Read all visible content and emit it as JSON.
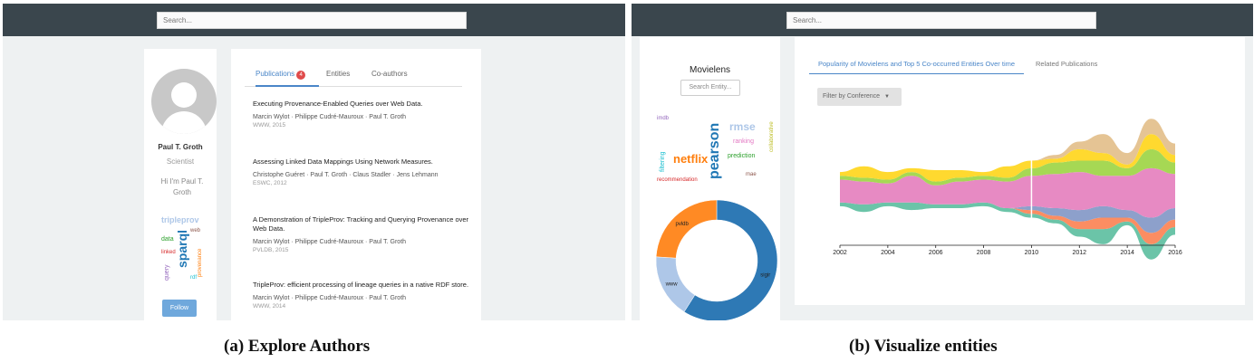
{
  "panel_a": {
    "search_placeholder": "Search...",
    "profile": {
      "name": "Paul T. Groth",
      "role": "Scientist",
      "greeting": "Hi I'm Paul T. Groth",
      "follow_label": "Follow",
      "word_cloud": [
        "tripleprov",
        "sparql",
        "data",
        "linked",
        "query",
        "web",
        "rdf",
        "provenance"
      ]
    },
    "tabs": [
      {
        "label": "Publications",
        "badge": "4",
        "active": true
      },
      {
        "label": "Entities",
        "active": false
      },
      {
        "label": "Co-authors",
        "active": false
      }
    ],
    "publications": [
      {
        "title": "Executing Provenance-Enabled Queries over Web Data.",
        "authors": "Marcin Wylot · Philippe Cudré-Mauroux · Paul T. Groth",
        "venue": "WWW, 2015"
      },
      {
        "title": "Assessing Linked Data Mappings Using Network Measures.",
        "authors": "Christophe Guéret · Paul T. Groth · Claus Stadler · Jens Lehmann",
        "venue": "ESWC, 2012"
      },
      {
        "title": "A Demonstration of TripleProv: Tracking and Querying Provenance over Web Data.",
        "authors": "Marcin Wylot · Philippe Cudré-Mauroux · Paul T. Groth",
        "venue": "PVLDB, 2015"
      },
      {
        "title": "TripleProv: efficient processing of lineage queries in a native RDF store.",
        "authors": "Marcin Wylot · Philippe Cudré-Mauroux · Paul T. Groth",
        "venue": "WWW, 2014"
      }
    ]
  },
  "panel_b": {
    "search_placeholder": "Search...",
    "entity": {
      "title": "Movielens",
      "search_placeholder": "Search Entity...",
      "word_cloud": [
        "pearson",
        "netflix",
        "recommendation",
        "rmse",
        "prediction",
        "imdb",
        "mae",
        "ranking",
        "filtering",
        "collaborative"
      ]
    },
    "chart_tabs": [
      {
        "label": "Popularity of Movielens and Top 5 Co-occurred Entities Over time",
        "active": true
      },
      {
        "label": "Related Publications",
        "active": false
      }
    ],
    "filter_label": "Filter by Conference",
    "donut": {
      "colors": [
        "#2e79b5",
        "#aec7e8",
        "#ff8a24"
      ],
      "slices": [
        {
          "label": "sigir",
          "value": 0.59
        },
        {
          "label": "www",
          "value": 0.17
        },
        {
          "label": "pvldb",
          "value": 0.24
        }
      ]
    }
  },
  "chart_data": {
    "type": "area",
    "x": [
      2002,
      2003,
      2004,
      2005,
      2006,
      2007,
      2008,
      2009,
      2010,
      2011,
      2012,
      2013,
      2014,
      2015,
      2016
    ],
    "xticks": [
      "2002",
      "2004",
      "2006",
      "2008",
      "2010",
      "2012",
      "2014",
      "2016"
    ],
    "stacked": true,
    "baseline": "wiggle",
    "series": [
      {
        "color": "#6bc4a8",
        "values": [
          1,
          2,
          1,
          2,
          1,
          1,
          1,
          1,
          1,
          1,
          2,
          4,
          1,
          4,
          2
        ]
      },
      {
        "color": "#fc8d62",
        "values": [
          0,
          0,
          0,
          0,
          0,
          0,
          0,
          0,
          1,
          1,
          2,
          3,
          1,
          3,
          2
        ]
      },
      {
        "color": "#8da0cb",
        "values": [
          0,
          0,
          0,
          0,
          0,
          0,
          0,
          0,
          1,
          2,
          3,
          3,
          2,
          4,
          3
        ]
      },
      {
        "color": "#e78ac3",
        "values": [
          6,
          6,
          5,
          7,
          5,
          6,
          6,
          7,
          8,
          9,
          10,
          8,
          9,
          13,
          9
        ]
      },
      {
        "color": "#a6d854",
        "values": [
          1,
          1,
          1,
          1,
          1,
          1,
          1,
          1,
          2,
          3,
          3,
          4,
          2,
          5,
          3
        ]
      },
      {
        "color": "#ffd92f",
        "values": [
          1,
          3,
          2,
          1,
          3,
          2,
          1,
          3,
          2,
          1,
          3,
          2,
          1,
          4,
          2
        ]
      },
      {
        "color": "#e5c494",
        "values": [
          0,
          0,
          0,
          0,
          0,
          0,
          0,
          0,
          0,
          1,
          2,
          5,
          3,
          4,
          3
        ]
      }
    ],
    "cursor_x": 2010
  },
  "captions": {
    "a": "(a) Explore Authors",
    "b": "(b) Visualize entities"
  }
}
